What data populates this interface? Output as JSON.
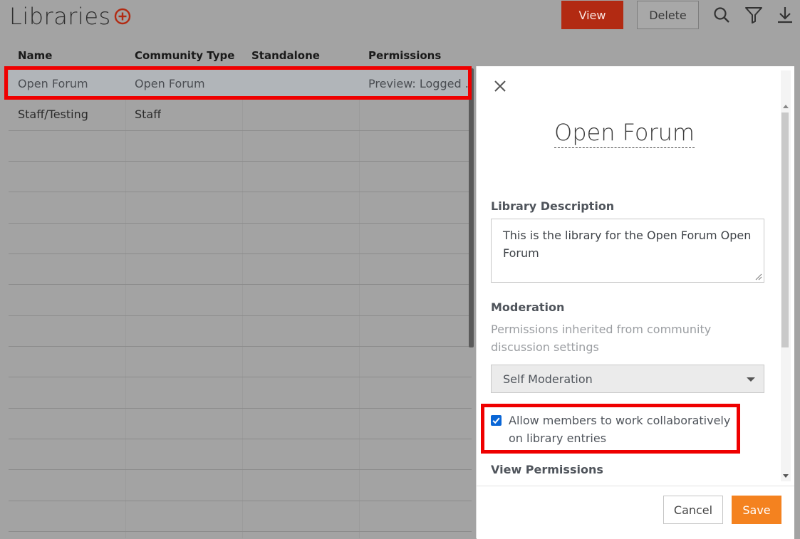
{
  "header": {
    "title": "Libraries",
    "view_label": "View",
    "delete_label": "Delete"
  },
  "table": {
    "columns": [
      "Name",
      "Community Type",
      "Standalone",
      "Permissions"
    ],
    "rows": [
      {
        "name": "Open Forum",
        "community_type": "Open Forum",
        "standalone": "",
        "permissions": "Preview: Logged ...",
        "selected": true
      },
      {
        "name": "Staff/Testing",
        "community_type": "Staff",
        "standalone": "",
        "permissions": "",
        "selected": false
      }
    ]
  },
  "panel": {
    "title": "Open Forum",
    "description_label": "Library Description",
    "description_value": "This is the library for the Open Forum Open Forum",
    "moderation_label": "Moderation",
    "moderation_note": "Permissions inherited from community discussion settings",
    "moderation_select": "Self Moderation",
    "collab_checkbox_label": "Allow members to work collaboratively on library entries",
    "collab_checked": true,
    "view_permissions_label": "View Permissions",
    "cancel_label": "Cancel",
    "save_label": "Save"
  },
  "colors": {
    "accent_primary": "#b22a12",
    "save_orange": "#f4821f",
    "checkbox_blue": "#0a66d6",
    "highlight_red": "#ef0000"
  },
  "icons": [
    "add-circle-icon",
    "search-icon",
    "filter-icon",
    "download-icon",
    "close-icon",
    "chevron-down-icon"
  ]
}
